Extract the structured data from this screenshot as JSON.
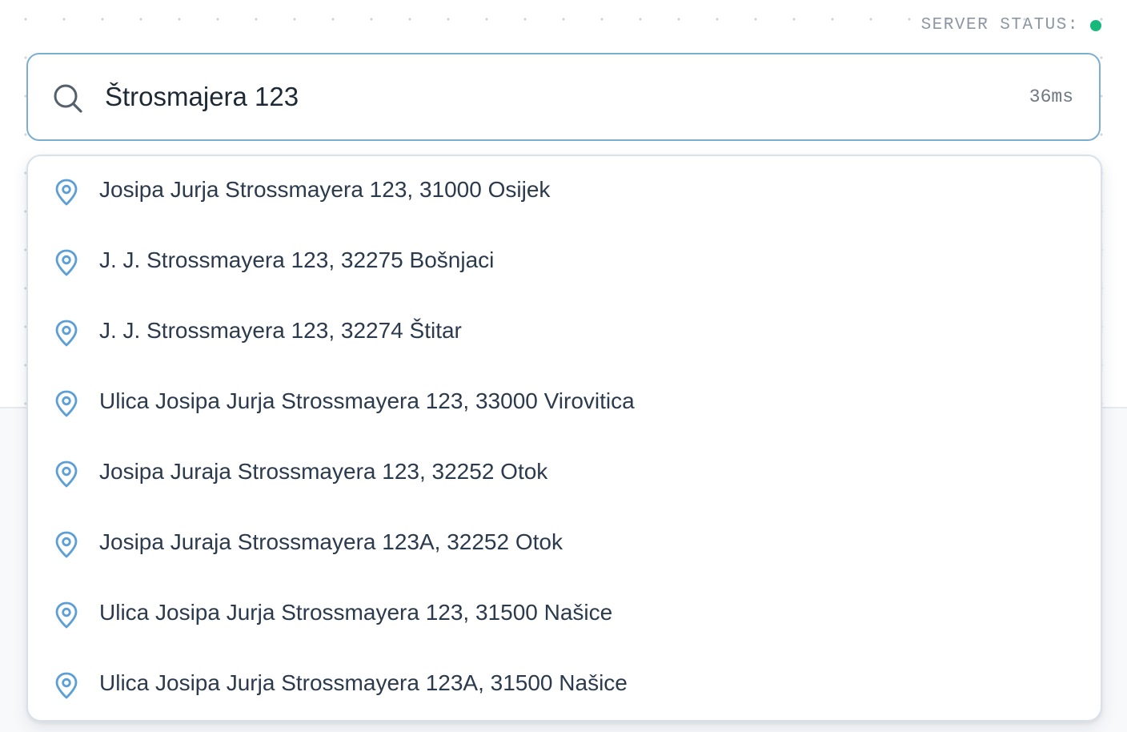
{
  "server_status": {
    "label": "SERVER STATUS:",
    "state": "online",
    "indicator_color": "#16b97b"
  },
  "search": {
    "value": "Štrosmajera 123",
    "latency": "36ms",
    "icon": "search-icon",
    "border_color": "#7eaecf"
  },
  "suggestions": [
    "Josipa Jurja Strossmayera 123, 31000 Osijek",
    "J. J. Strossmayera 123, 32275 Bošnjaci",
    "J. J. Strossmayera 123, 32274 Štitar",
    "Ulica Josipa Jurja Strossmayera 123, 33000 Virovitica",
    "Josipa Juraja Strossmayera 123, 32252 Otok",
    "Josipa Juraja Strossmayera 123A, 32252 Otok",
    "Ulica Josipa Jurja Strossmayera 123, 31500 Našice",
    "Ulica Josipa Jurja Strossmayera 123A, 31500 Našice"
  ],
  "colors": {
    "pin_icon": "#5b9fd6",
    "text": "#2b3a4d"
  }
}
